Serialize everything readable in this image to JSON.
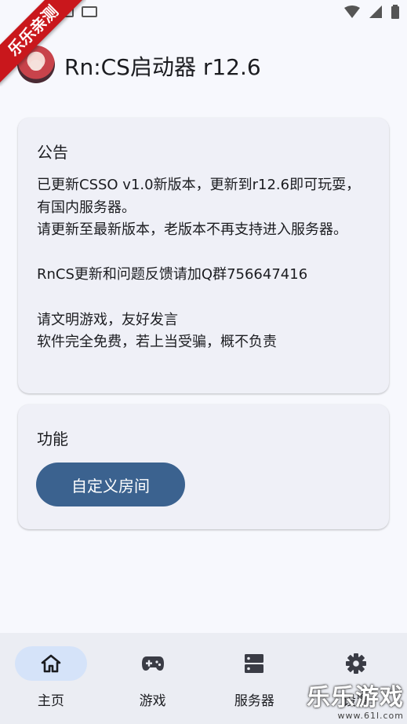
{
  "watermark": {
    "ribbon": "乐乐亲测",
    "bottom_brand": "乐乐游戏",
    "bottom_url": "www.61l.com"
  },
  "header": {
    "title": "Rn:CS启动器 r12.6"
  },
  "notice": {
    "title": "公告",
    "body": "已更新CSSO v1.0新版本，更新到r12.6即可玩耍，有国内服务器。\n请更新至最新版本，老版本不再支持进入服务器。\n\nRnCS更新和问题反馈请加Q群756647416\n\n请文明游戏，友好发言\n软件完全免费，若上当受骗，概不负责"
  },
  "features": {
    "title": "功能",
    "custom_room_button": "自定义房间"
  },
  "nav": {
    "items": [
      {
        "label": "主页",
        "icon": "home-icon",
        "active": true
      },
      {
        "label": "游戏",
        "icon": "gamepad-icon",
        "active": false
      },
      {
        "label": "服务器",
        "icon": "server-icon",
        "active": false
      },
      {
        "label": "设置",
        "icon": "gear-icon",
        "active": false
      }
    ]
  },
  "colors": {
    "accent": "#3b628f",
    "active_pill": "#d5e3f9",
    "background": "#f7f8fd",
    "card": "#eff0f7",
    "ribbon": "#c9171c"
  }
}
